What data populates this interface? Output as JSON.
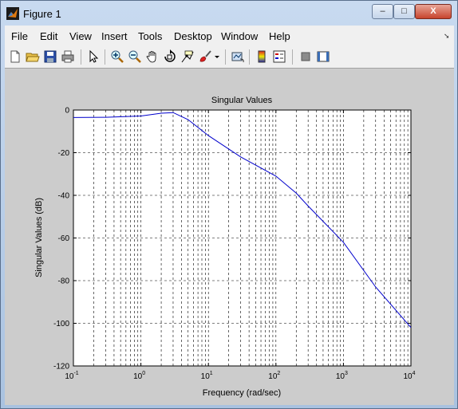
{
  "window": {
    "title": "Figure 1",
    "controls": {
      "minimize": "–",
      "maximize": "□",
      "close": "X"
    }
  },
  "menu": {
    "items": [
      "File",
      "Edit",
      "View",
      "Insert",
      "Tools",
      "Desktop",
      "Window",
      "Help"
    ]
  },
  "toolbar": {
    "icons": [
      "new-figure-icon",
      "open-file-icon",
      "save-icon",
      "print-icon",
      "edit-plot-icon",
      "zoom-in-icon",
      "zoom-out-icon",
      "pan-icon",
      "rotate-3d-icon",
      "data-cursor-icon",
      "brush-icon",
      "link-plot-icon",
      "colorbar-icon",
      "legend-icon",
      "hide-plot-tools-icon",
      "show-plot-tools-icon"
    ]
  },
  "chart_data": {
    "type": "line",
    "title": "Singular Values",
    "xlabel": "Frequency (rad/sec)",
    "ylabel": "Singular Values (dB)",
    "xscale": "log",
    "xlim": [
      0.1,
      10000
    ],
    "ylim": [
      -120,
      0
    ],
    "grid": true,
    "xticks": [
      {
        "base": "10",
        "exp": "-1",
        "value": 0.1
      },
      {
        "base": "10",
        "exp": "0",
        "value": 1
      },
      {
        "base": "10",
        "exp": "1",
        "value": 10
      },
      {
        "base": "10",
        "exp": "2",
        "value": 100
      },
      {
        "base": "10",
        "exp": "3",
        "value": 1000
      },
      {
        "base": "10",
        "exp": "4",
        "value": 10000
      }
    ],
    "yticks": [
      0,
      -20,
      -40,
      -60,
      -80,
      -100,
      -120
    ],
    "line_color": "#0000cc",
    "series": [
      {
        "x": [
          0.1,
          0.3,
          1,
          2,
          3,
          5,
          10,
          30,
          100,
          200,
          300,
          1000,
          3000,
          10000
        ],
        "y": [
          -3.5,
          -3.4,
          -2.8,
          -1.5,
          -1.2,
          -4.5,
          -12,
          -22,
          -31,
          -39,
          -45,
          -62,
          -83,
          -102
        ]
      }
    ]
  }
}
